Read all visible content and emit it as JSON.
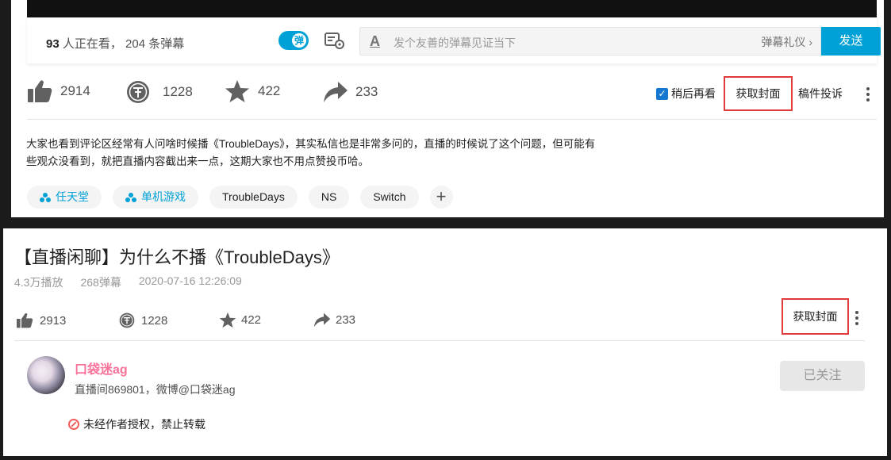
{
  "top": {
    "danmaku_bar": {
      "viewers": "93",
      "viewers_text": "人正在看，",
      "danmaku_count": "204",
      "danmaku_text": "条弹幕",
      "toggle_label": "弹",
      "placeholder": "发个友善的弹幕见证当下",
      "etiquette": "弹幕礼仪",
      "send": "发送"
    },
    "actions": {
      "like": "2914",
      "coin": "1228",
      "fav": "422",
      "share": "233",
      "watch_later": "稍后再看",
      "get_cover": "获取封面",
      "report": "稿件投诉"
    },
    "description": "大家也看到评论区经常有人问啥时候播《TroubleDays》，其实私信也是非常多问的，直播的时候说了这个问题，但可能有些观众没看到，就把直播内容截出来一点，这期大家也不用点赞投币哈。",
    "tags": [
      "任天堂",
      "单机游戏",
      "TroubleDays",
      "NS",
      "Switch"
    ]
  },
  "bottom": {
    "title": "【直播闲聊】为什么不播《TroubleDays》",
    "meta": {
      "plays": "4.3万播放",
      "danmaku": "268弹幕",
      "date": "2020-07-16 12:26:09"
    },
    "actions": {
      "like": "2913",
      "coin": "1228",
      "fav": "422",
      "share": "233",
      "get_cover": "获取封面"
    },
    "uploader": {
      "name": "口袋迷ag",
      "sign": "直播间869801，微博@口袋迷ag",
      "follow": "已关注"
    },
    "notice": "未经作者授权，禁止转载"
  },
  "colors": {
    "accent": "#00a1d6",
    "uploader": "#fb7299",
    "highlight_box": "#e23b3b"
  }
}
